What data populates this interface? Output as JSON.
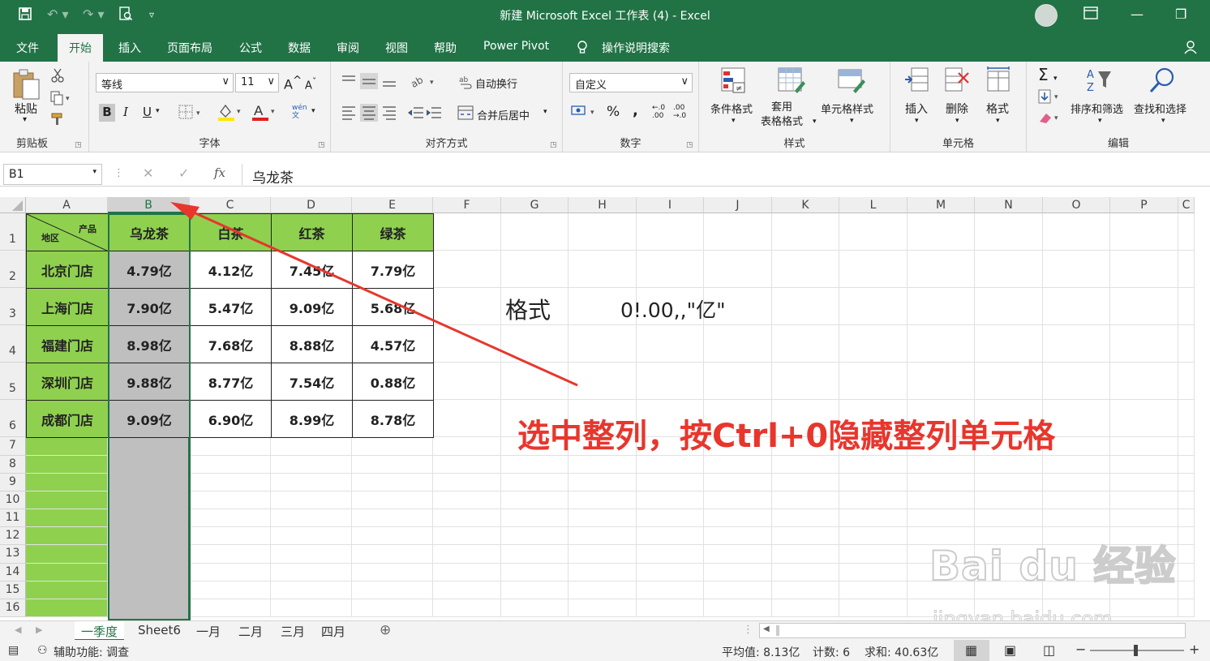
{
  "window": {
    "title": "新建 Microsoft Excel 工作表 (4)  -  Excel"
  },
  "menu": {
    "tabs": [
      "文件",
      "开始",
      "插入",
      "页面布局",
      "公式",
      "数据",
      "审阅",
      "视图",
      "帮助",
      "Power Pivot"
    ],
    "search_label": "操作说明搜索"
  },
  "ribbon": {
    "clipboard": {
      "paste": "粘贴",
      "group": "剪贴板"
    },
    "font": {
      "name": "等线",
      "size": "11",
      "group": "字体",
      "grow": "A",
      "shrink": "A",
      "bold": "B",
      "italic": "I",
      "underline": "U",
      "phonetic": "wén\n文"
    },
    "align": {
      "wrap": "自动换行",
      "merge": "合并后居中",
      "group": "对齐方式"
    },
    "number": {
      "format": "自定义",
      "group": "数字",
      "percent": "%",
      "comma": ",",
      "inc": "←.0\n.00",
      "dec": ".00\n→.0"
    },
    "styles": {
      "cond": "条件格式",
      "table": "套用\n表格格式",
      "cellstyle": "单元格样式",
      "group": "样式"
    },
    "cells": {
      "insert": "插入",
      "delete": "删除",
      "format": "格式",
      "group": "单元格"
    },
    "edit": {
      "sort": "排序和筛选",
      "find": "查找和选择",
      "group": "编辑"
    }
  },
  "formula_bar": {
    "name_box": "B1",
    "fx": "fx",
    "value": "乌龙茶"
  },
  "columns": [
    "A",
    "B",
    "C",
    "D",
    "E",
    "F",
    "G",
    "H",
    "I",
    "J",
    "K",
    "L",
    "M",
    "N",
    "O",
    "P",
    "C"
  ],
  "rows": [
    "1",
    "2",
    "3",
    "4",
    "5",
    "6",
    "7",
    "8",
    "9",
    "10",
    "11",
    "12",
    "13",
    "14",
    "15",
    "16"
  ],
  "table": {
    "corner_top": "产品",
    "corner_bottom": "地区",
    "headers": [
      "乌龙茶",
      "白茶",
      "红茶",
      "绿茶"
    ],
    "rows": [
      {
        "store": "北京门店",
        "values": [
          "4.79亿",
          "4.12亿",
          "7.45亿",
          "7.79亿"
        ]
      },
      {
        "store": "上海门店",
        "values": [
          "7.90亿",
          "5.47亿",
          "9.09亿",
          "5.68亿"
        ]
      },
      {
        "store": "福建门店",
        "values": [
          "8.98亿",
          "7.68亿",
          "8.88亿",
          "4.57亿"
        ]
      },
      {
        "store": "深圳门店",
        "values": [
          "9.88亿",
          "8.77亿",
          "7.54亿",
          "0.88亿"
        ]
      },
      {
        "store": "成都门店",
        "values": [
          "9.09亿",
          "6.90亿",
          "8.99亿",
          "8.78亿"
        ]
      }
    ]
  },
  "notes": {
    "format_label": "格式",
    "format_value": "0!.00,,\"亿\"",
    "instruction": "选中整列，按Ctrl+0隐藏整列单元格"
  },
  "sheets": [
    "一季度",
    "Sheet6",
    "一月",
    "二月",
    "三月",
    "四月"
  ],
  "status": {
    "accessibility": "辅助功能: 调查",
    "average": "平均值: 8.13亿",
    "count": "计数: 6",
    "sum": "求和: 40.63亿"
  },
  "watermark": {
    "brand": "Bai du 经验",
    "url": "jingyan.baidu.com"
  },
  "colors": {
    "excel_green": "#217346",
    "header_fill": "#8fd14f",
    "selected_fill": "#bfbfbf",
    "annotation": "#e8362d"
  }
}
